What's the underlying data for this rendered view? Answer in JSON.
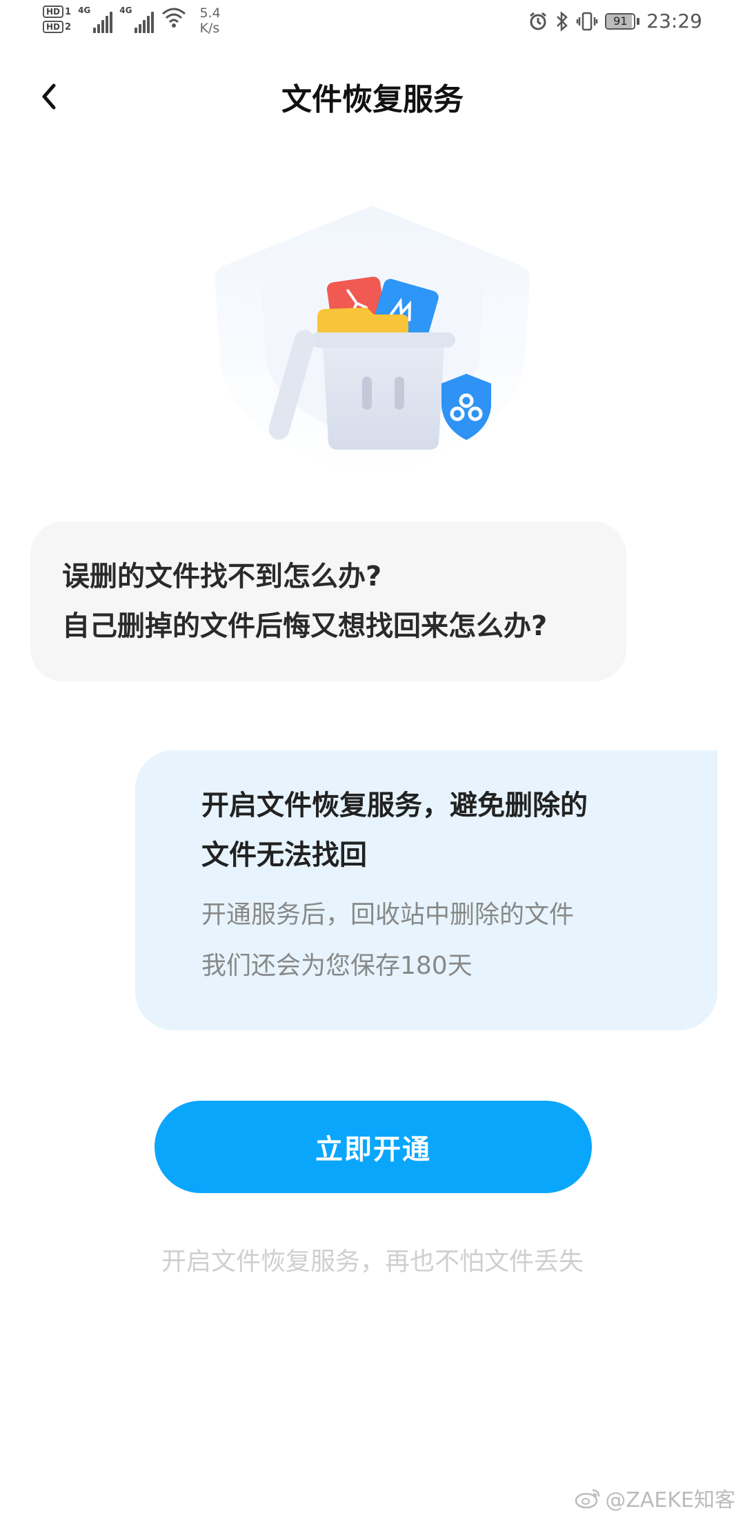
{
  "status_bar": {
    "hd1": "HD",
    "hd1_sub": "1",
    "hd2": "HD",
    "hd2_sub": "2",
    "network1": "4G",
    "network2": "4G",
    "speed_value": "5.4",
    "speed_unit": "K/s",
    "battery": "91",
    "battery_level": 0.91,
    "time": "23:29"
  },
  "header": {
    "title": "文件恢复服务",
    "back_icon": "chevron-left-icon"
  },
  "illustration": {
    "icon": "trash-bin-with-files-shield-icon"
  },
  "question": {
    "line1": "误删的文件找不到怎么办?",
    "line2": "自己删掉的文件后悔又想找回来怎么办?"
  },
  "answer": {
    "heading_line1": "开启文件恢复服务，避免删除的",
    "heading_line2": "文件无法找回",
    "detail_line1": "开通服务后，回收站中删除的文件",
    "detail_line2": "我们还会为您保存180天"
  },
  "cta": {
    "label": "立即开通",
    "color": "#0aa6fc"
  },
  "tagline": "开启文件恢复服务，再也不怕文件丢失",
  "watermark": {
    "icon": "weibo-icon",
    "text": "@ZAEKE知客"
  }
}
